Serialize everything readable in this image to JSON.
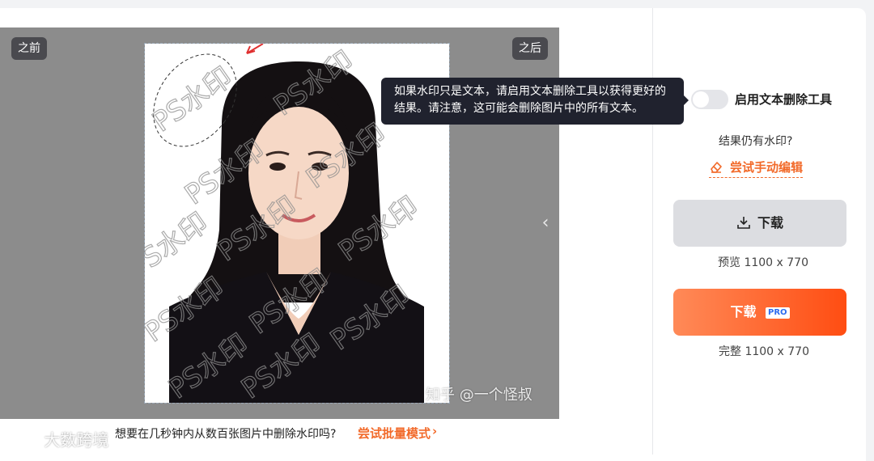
{
  "editor": {
    "before_label": "之前",
    "after_label": "之后",
    "watermark_text": "PS水印",
    "credit": "知乎 @一个怪叔",
    "tooltip": "如果水印只是文本，请启用文本删除工具以获得更好的结果。请注意，这可能会删除图片中的所有文本。"
  },
  "bottom": {
    "question": "想要在几秒钟内从数百张图片中删除水印吗?",
    "batch_link": "尝试批量模式",
    "chevron": "›",
    "brand": "大数跨境"
  },
  "panel": {
    "toggle_label": "启用文本删除工具",
    "toggle_on": false,
    "still_watermark": "结果仍有水印?",
    "manual_edit": "尝试手动编辑",
    "download_label": "下载",
    "preview_size": "预览 1100 x 770",
    "download_pro_label": "下载",
    "pro_badge": "PRO",
    "full_size": "完整 1100 x 770"
  },
  "colors": {
    "accent": "#f26a2a",
    "canvas_bg": "#8c8c8c",
    "tooltip_bg": "#20222e"
  },
  "icons": [
    "download-icon",
    "eraser-icon",
    "chevron-left-icon",
    "chevron-right-icon"
  ]
}
